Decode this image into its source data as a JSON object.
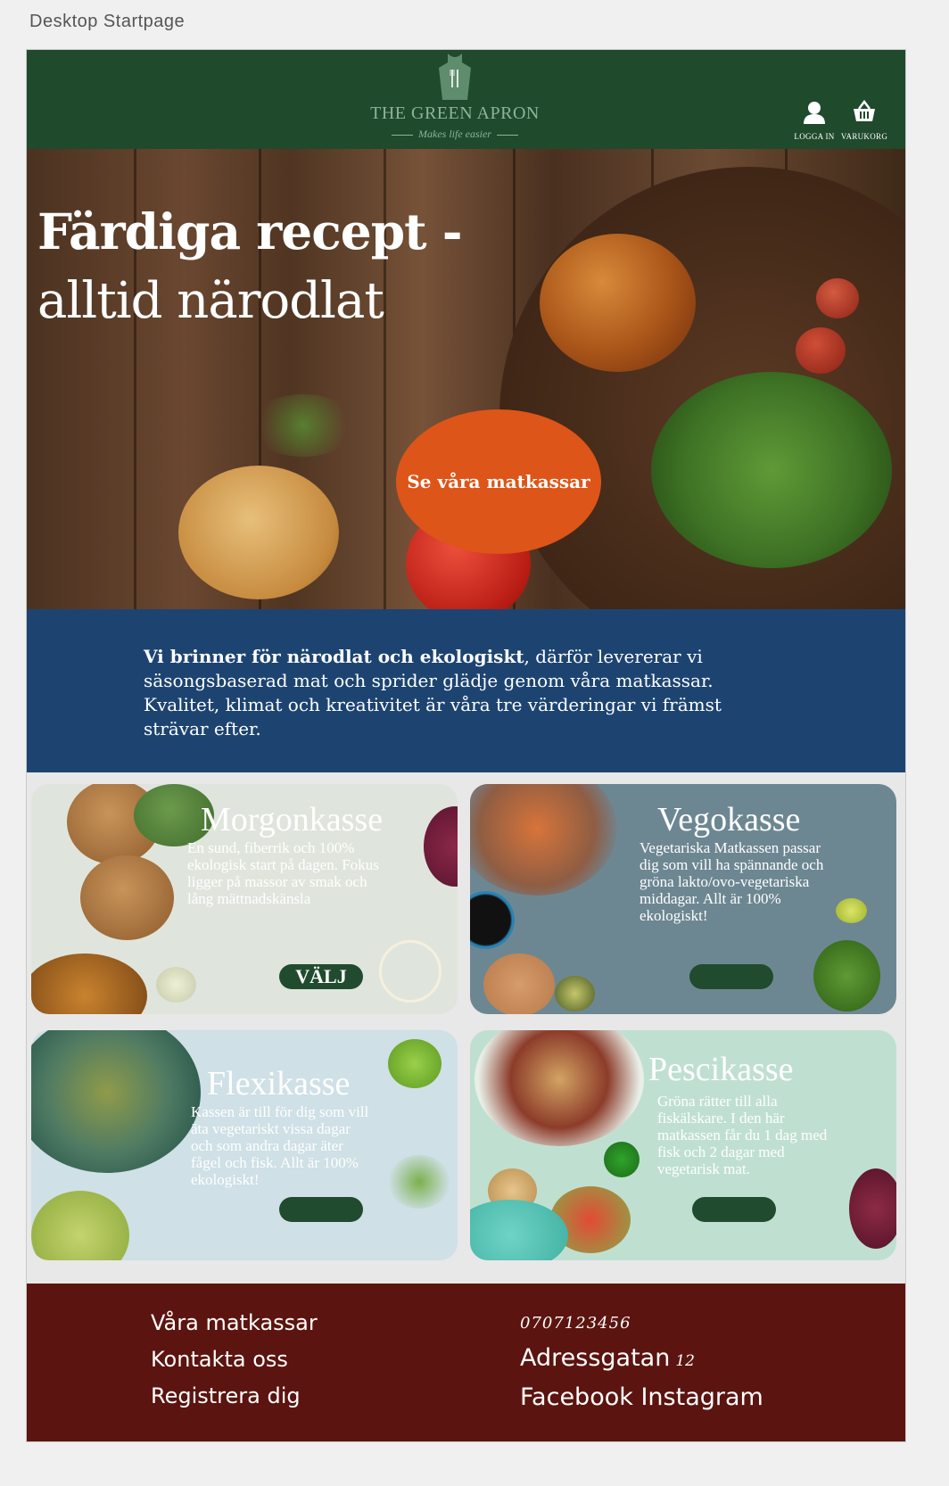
{
  "artboard": {
    "label": "Desktop Startpage"
  },
  "header": {
    "brand": "THE GREEN APRON",
    "tagline": "Makes life easier",
    "login_label": "LOGGA IN",
    "cart_label": "VARUKORG"
  },
  "hero": {
    "title": "Färdiga recept -",
    "subtitle": "alltid närodlat",
    "cta_label": "Se våra matkassar"
  },
  "mission": {
    "lead": "Vi brinner för närodlat och ekologiskt",
    "text": ", därför levererar vi säsongsbaserad mat och sprider glädje genom våra matkassar. Kvalitet, klimat och kreativitet är våra tre värderingar vi främst strävar efter."
  },
  "cards": [
    {
      "title": "Morgonkasse",
      "text": "En sund, fiberrik och 100% ekologisk start på dagen. Fokus ligger på massor av smak och lång mättnadskänsla",
      "button": "VÄLJ"
    },
    {
      "title": "Vegokasse",
      "text": "Vegetariska Matkassen passar dig som vill ha spännande och gröna lakto/ovo-vegetariska middagar. Allt är 100% ekologiskt!",
      "button": ""
    },
    {
      "title": "Flexikasse",
      "text": "Kassen är till för dig som vill äta vegetariskt vissa dagar och som andra dagar äter fågel och fisk. Allt är 100% ekologiskt!",
      "button": ""
    },
    {
      "title": "Pescikasse",
      "text": "Gröna rätter till alla fiskälskare. I den här matkassen får du 1 dag med fisk och 2 dagar med vegetarisk mat.",
      "button": ""
    }
  ],
  "footer": {
    "links": [
      "Våra matkassar",
      "Kontakta oss",
      "Registrera dig"
    ],
    "phone": "0707123456",
    "street": "Adressgatan",
    "street_number": "12",
    "social": [
      "Facebook",
      "Instagram"
    ]
  },
  "colors": {
    "header_green": "#1f4a2c",
    "mission_blue": "#1d4471",
    "cta_orange": "#dd5518",
    "footer_red": "#5b140f",
    "button_green": "#214b2e"
  }
}
